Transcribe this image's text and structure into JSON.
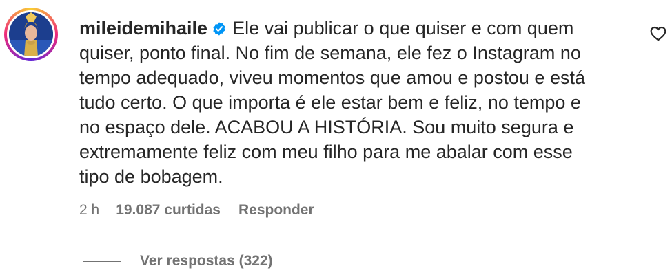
{
  "comment": {
    "username": "mileidemihaile",
    "text": "Ele vai publicar o que quiser e com quem\nquiser, ponto final. No fim de semana, ele fez o Instagram no\ntempo adequado, viveu momentos que amou e postou e está\ntudo certo. O que importa é ele estar bem e feliz, no tempo e\nno espaço dele. ACABOU A HISTÓRIA. Sou muito segura e\nextremamente feliz com meu filho para me abalar com esse\ntipo de bobagem.",
    "time": "2 h",
    "likes": "19.087 curtidas",
    "reply_label": "Responder",
    "view_replies_label": "Ver respostas (322)"
  },
  "icons": {
    "avatar": "avatar",
    "verified": "verified-badge-icon",
    "like": "heart-outline-icon"
  },
  "colors": {
    "text": "#262626",
    "secondary": "#737373",
    "verified": "#0095f6",
    "background": "#ffffff"
  }
}
